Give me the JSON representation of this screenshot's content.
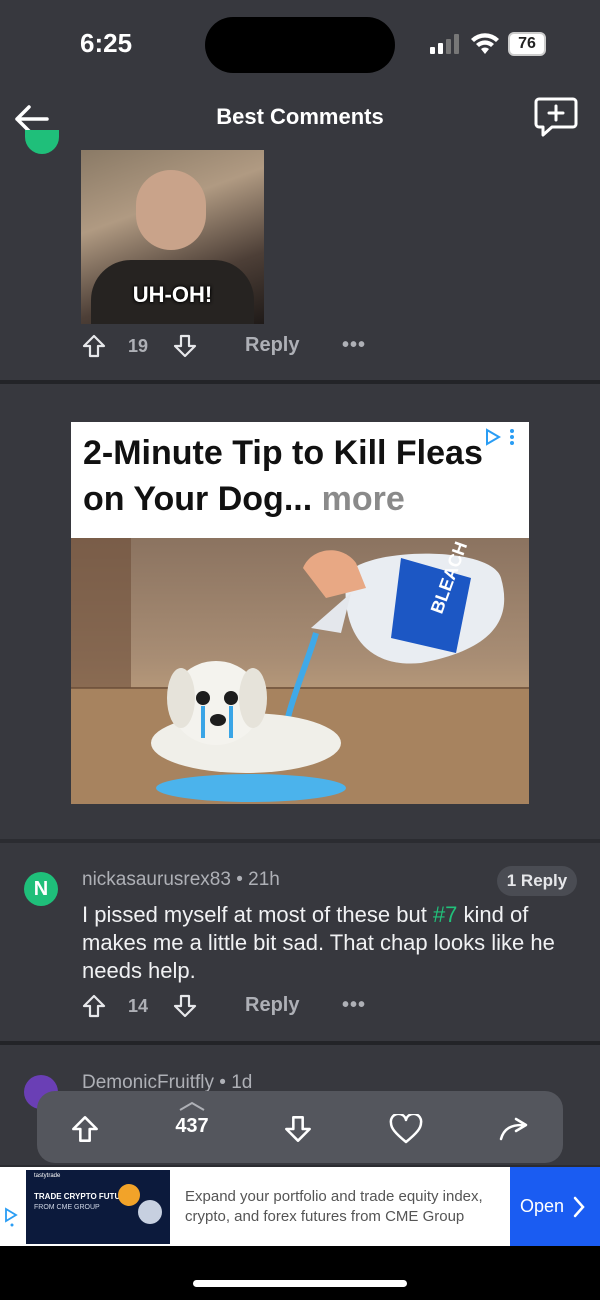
{
  "status_bar": {
    "time": "6:25",
    "battery": "76"
  },
  "header": {
    "title": "Best Comments",
    "back_icon": "arrow-left-icon",
    "new_comment_icon": "add-comment-icon"
  },
  "comment_top": {
    "gif_caption": "UH-OH!",
    "upvotes": "19",
    "reply_label": "Reply",
    "more_label": "•••"
  },
  "ad": {
    "headline": "2-Minute Tip to Kill Fleas on Your Dog...",
    "more_label": "more",
    "bottle_label": "BLEACH"
  },
  "comment_main": {
    "avatar_letter": "N",
    "username": "nickasaurusrex83",
    "separator": "•",
    "time": "21h",
    "reply_count_label": "1 Reply",
    "text_before": "I pissed myself at most of these but ",
    "highlight": "#7",
    "text_after": " kind of makes me a little bit sad. That chap looks like he needs help.",
    "upvotes": "14",
    "reply_label": "Reply",
    "more_label": "•••"
  },
  "comment_next": {
    "username": "DemonicFruitfly",
    "separator": "•",
    "time": "1d"
  },
  "vote_bar": {
    "count": "437"
  },
  "banner_ad": {
    "brand": "tastytrade",
    "image_title": "TRADE CRYPTO FUTURES",
    "image_sub": "FROM CME GROUP",
    "text": "Expand your portfolio and trade equity index, crypto, and forex futures from CME Group",
    "open_label": "Open"
  },
  "colors": {
    "accent_green": "#21c07a",
    "open_blue": "#1a5cf2",
    "background": "#2b2c31",
    "card": "#37383e"
  }
}
